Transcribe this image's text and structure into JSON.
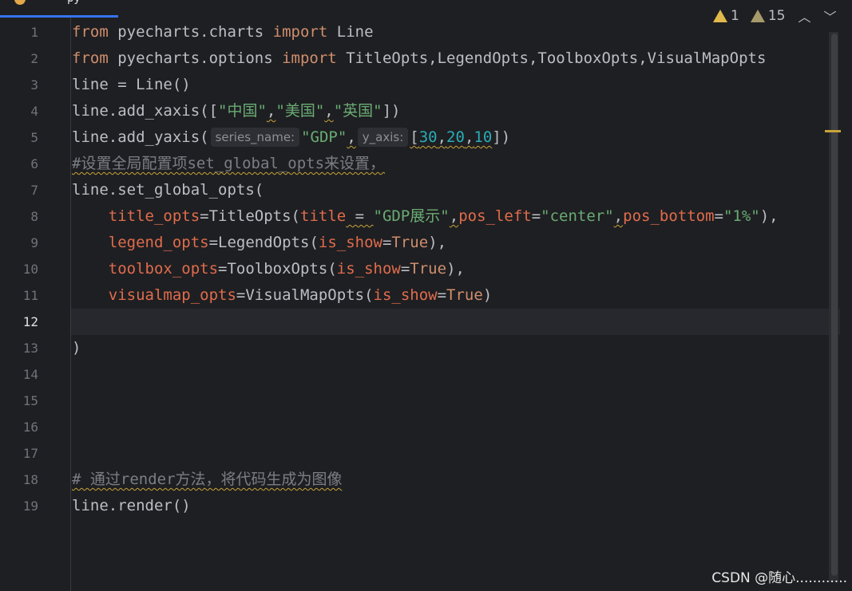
{
  "tab": {
    "label": "py"
  },
  "inspections": {
    "warnings": "1",
    "weak_warnings": "15"
  },
  "gutter": {
    "line_numbers": [
      "1",
      "2",
      "3",
      "4",
      "5",
      "6",
      "7",
      "8",
      "9",
      "10",
      "11",
      "12",
      "13",
      "14",
      "15",
      "16",
      "17",
      "18",
      "19"
    ],
    "current_line": "12"
  },
  "code": {
    "l1": {
      "kw1": "from",
      "mod": " pyecharts.charts ",
      "kw2": "import",
      "name": " Line"
    },
    "l2": {
      "kw1": "from",
      "mod": " pyecharts.options ",
      "kw2": "import",
      "names": " TitleOpts,LegendOpts,ToolboxOpts,VisualMapOpts"
    },
    "l3": {
      "text": "line = Line()"
    },
    "l4": {
      "pre": "line.add_xaxis([",
      "s1": "\"中国\"",
      "c1": ",",
      "s2": "\"美国\"",
      "c2": ",",
      "s3": "\"英国\"",
      "post": "])"
    },
    "l5": {
      "pre": "line.add_yaxis(",
      "hint1": "series_name:",
      "s1": "\"GDP\"",
      "c1": ",",
      "hint2": "y_axis:",
      "open": "[",
      "n1": "30",
      "c2": ",",
      "n2": "20",
      "c3": ",",
      "n3": "10",
      "close": "])"
    },
    "l6": {
      "comment": "#设置全局配置项set_global_opts来设置，"
    },
    "l7": {
      "text": "line.set_global_opts("
    },
    "l8": {
      "indent": "    ",
      "p1": "title_opts",
      "a1": "=TitleOpts(",
      "p2": "title",
      "sp": " = ",
      "s1": "\"GDP展示\"",
      "c1": ",",
      "p3": "pos_left",
      "eq1": "=",
      "s2": "\"center\"",
      "c2": ",",
      "p4": "pos_bottom",
      "eq2": "=",
      "s3": "\"1%\"",
      "end": "),"
    },
    "l9": {
      "indent": "    ",
      "p1": "legend_opts",
      "a1": "=LegendOpts(",
      "p2": "is_show",
      "eq": "=",
      "kw": "True",
      "end": "),"
    },
    "l10": {
      "indent": "    ",
      "p1": "toolbox_opts",
      "a1": "=ToolboxOpts(",
      "p2": "is_show",
      "eq": "=",
      "kw": "True",
      "end": "),"
    },
    "l11": {
      "indent": "    ",
      "p1": "visualmap_opts",
      "a1": "=VisualMapOpts(",
      "p2": "is_show",
      "eq": "=",
      "kw": "True",
      "end": ")"
    },
    "l13": {
      "text": ")"
    },
    "l18": {
      "comment": "# 通过render方法，将代码生成为图像"
    },
    "l19": {
      "text": "line.render()"
    }
  },
  "watermark": "CSDN @随心............"
}
